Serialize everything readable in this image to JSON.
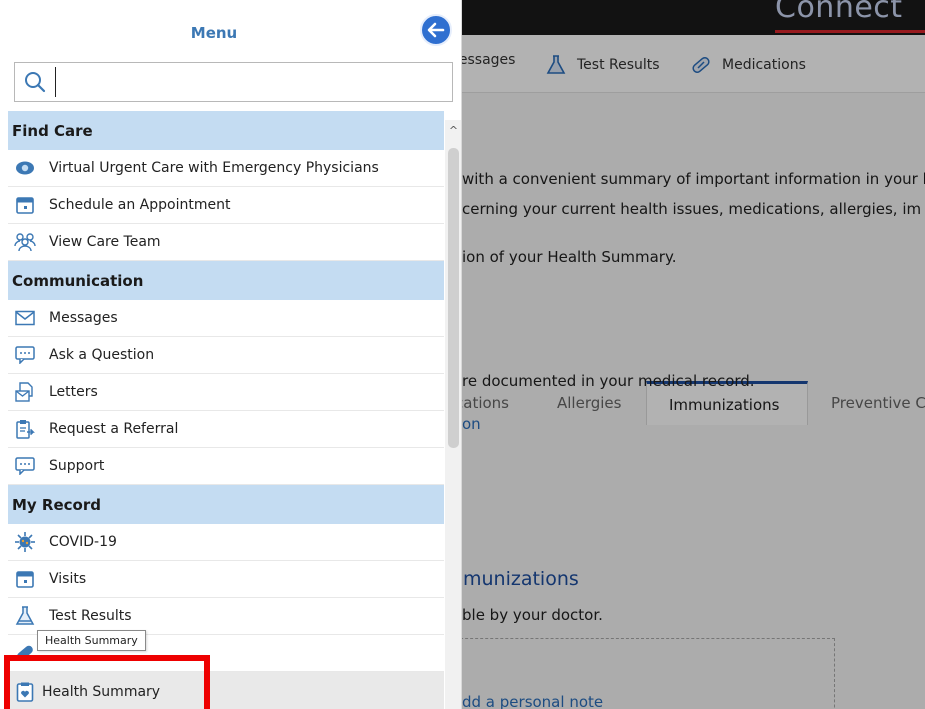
{
  "background": {
    "brand": "Connect",
    "nav_items": [
      {
        "label": "lessages",
        "icon": "envelope-icon"
      },
      {
        "label": "Test Results",
        "icon": "flask-icon"
      },
      {
        "label": "Medications",
        "icon": "pill-icon"
      }
    ],
    "intro_line1": "with a convenient summary of important information in your h",
    "intro_line2": "cerning your current health issues, medications, allergies, im",
    "intro_line3": "ion of your Health Summary.",
    "tabs": [
      "cations",
      "Allergies",
      "Immunizations",
      "Preventive C"
    ],
    "active_tab": "Immunizations",
    "documented_text": "re documented in your medical record.",
    "link_fragment": "on",
    "heading": "munizations",
    "subtext": "ble by your doctor.",
    "note_link": "dd a personal note"
  },
  "menu": {
    "title": "Menu",
    "search": {
      "value": "",
      "placeholder": ""
    },
    "sections": [
      {
        "title": "Find Care",
        "items": [
          {
            "label": "Virtual Urgent Care with Emergency Physicians",
            "icon": "video-visit-icon"
          },
          {
            "label": "Schedule an Appointment",
            "icon": "calendar-icon"
          },
          {
            "label": "View Care Team",
            "icon": "care-team-icon"
          }
        ]
      },
      {
        "title": "Communication",
        "items": [
          {
            "label": "Messages",
            "icon": "envelope-icon"
          },
          {
            "label": "Ask a Question",
            "icon": "chat-bubble-icon"
          },
          {
            "label": "Letters",
            "icon": "letter-icon"
          },
          {
            "label": "Request a Referral",
            "icon": "referral-icon"
          },
          {
            "label": "Support",
            "icon": "chat-bubble-icon"
          }
        ]
      },
      {
        "title": "My Record",
        "items": [
          {
            "label": "COVID-19",
            "icon": "virus-icon"
          },
          {
            "label": "Visits",
            "icon": "calendar-icon"
          },
          {
            "label": "Test Results",
            "icon": "flask-icon"
          },
          {
            "label": "",
            "icon": "pill-icon"
          },
          {
            "label": "Health Summary",
            "icon": "health-summary-icon"
          }
        ]
      }
    ],
    "tooltip": "Health Summary"
  },
  "colors": {
    "section_bg": "#c4dcf2",
    "menu_title": "#3c78b4",
    "back_button": "#2f6fd0",
    "highlight_border": "#ee0000"
  }
}
